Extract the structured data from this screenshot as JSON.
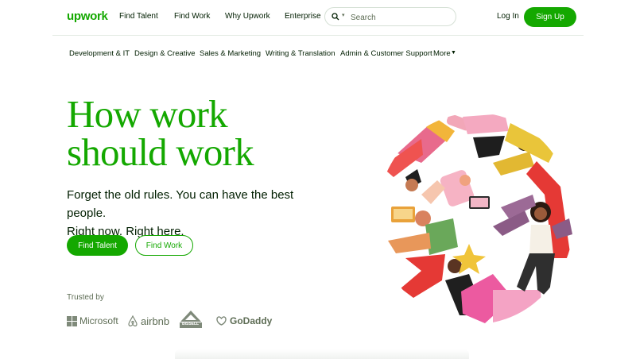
{
  "brand": {
    "logo": "upwork",
    "color": "#14a800"
  },
  "nav": {
    "find_talent": "Find Talent",
    "find_work": "Find Work",
    "why_upwork": "Why Upwork",
    "enterprise": "Enterprise",
    "search_placeholder": "Search",
    "search_icon": "search-icon",
    "login": "Log In",
    "signup": "Sign Up"
  },
  "categories": {
    "items": [
      "Development & IT",
      "Design & Creative",
      "Sales & Marketing",
      "Writing & Translation",
      "Admin & Customer Support"
    ],
    "more": "More"
  },
  "hero": {
    "headline_line1": "How work",
    "headline_line2": "should work",
    "sub_line1": "Forget the old rules. You can have the best people.",
    "sub_line2": "Right now. Right here.",
    "primary_cta": "Find Talent",
    "secondary_cta": "Find Work"
  },
  "trusted": {
    "label": "Trusted by",
    "logos": [
      "Microsoft",
      "airbnb",
      "BISSELL",
      "GoDaddy"
    ]
  },
  "colors": {
    "accent": "#14a800",
    "text": "#001e00",
    "muted": "#5e6d55"
  }
}
